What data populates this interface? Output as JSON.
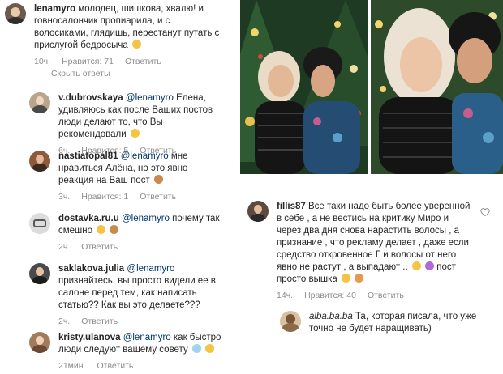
{
  "comments": [
    {
      "user": "lenamyro",
      "mention": "",
      "text": "молодец, шишкова, хвалю! и говносалончик пропиарила, и с волосиками, глядишь, перестанут путать с прислугой бедросыча",
      "time": "10ч.",
      "likes": "Нравится: 71",
      "reply": "Ответить"
    },
    {
      "user": "v.dubrovskaya",
      "mention": "@lenamyro",
      "text": "Елена, удивляюсь как после Ваших постов люди делают то, что Вы рекомендовали",
      "time": "6ч.",
      "likes": "Нравится: 5",
      "reply": "Ответить"
    },
    {
      "user": "nastiatopal81",
      "mention": "@lenamyro",
      "text": "мне нравиться Алёна, но это явно реакция на Ваш пост",
      "time": "3ч.",
      "likes": "Нравится: 1",
      "reply": "Ответить"
    },
    {
      "user": "dostavka.ru.u",
      "mention": "@lenamyro",
      "text": "почему так смешно",
      "time": "2ч.",
      "likes": "",
      "reply": "Ответить"
    },
    {
      "user": "saklakova.julia",
      "mention": "@lenamyro",
      "text": "признайтесь, вы просто видели ее в салоне перед тем, как написать статью?? Как вы это делаете???",
      "time": "2ч.",
      "likes": "",
      "reply": "Ответить"
    },
    {
      "user": "kristy.ulanova",
      "mention": "@lenamyro",
      "text": "как быстро люди следуют вашему совету",
      "time": "21мин.",
      "likes": "",
      "reply": "Ответить"
    }
  ],
  "hide_replies": "Скрыть ответы",
  "right_comments": [
    {
      "user": "fillis87",
      "text": "Все таки надо быть более уверенной в себе , а не вестись на критику Миро и через два дня снова нарастить волосы , а признание , что рекламу делает , даже если средство откровенное Г и волосы от него явно не растут , а выпадают ..",
      "text2": "пост просто вышка",
      "time": "14ч.",
      "likes": "Нравится: 40",
      "reply": "Ответить"
    },
    {
      "user": "alba.ba.ba",
      "text": "Та, которая писала, что уже точно не будет наращивать)"
    }
  ]
}
